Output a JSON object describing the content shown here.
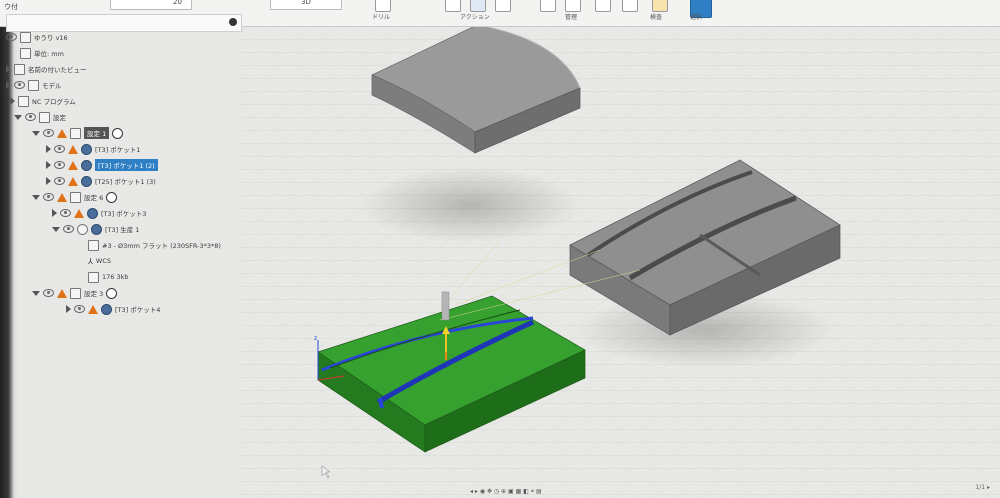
{
  "toolbar": {
    "zoom_label": "20",
    "view_label": "3D",
    "drill_label": "ドリル",
    "action_label": "アクション",
    "manage_label": "管理",
    "inspect_label": "検査",
    "select_label": "選択",
    "left_label": "ウ付"
  },
  "browser": {
    "title": "",
    "items": [
      {
        "label": "ゆうり v16"
      },
      {
        "label": "単位: mm"
      },
      {
        "label": "名前の付いたビュー"
      },
      {
        "label": "モデル"
      },
      {
        "label": "NC プログラム"
      },
      {
        "label": "設定"
      },
      {
        "label": "設定 1"
      },
      {
        "label": "[T3] ポケット1"
      },
      {
        "label": "[T3] ポケット1 (2)"
      },
      {
        "label": "[T25] ポケット1 (3)"
      },
      {
        "label": "設定 6"
      },
      {
        "label": "[T3] ポケット3"
      },
      {
        "label": "[T3] 生産 1"
      },
      {
        "label": "#3 - Ø3mm フラット (230SFR-3*3*8)"
      },
      {
        "label": "WCS"
      },
      {
        "label": "176 3kb"
      },
      {
        "label": "設定 3"
      },
      {
        "label": "[T3] ポケット4"
      }
    ]
  },
  "colors": {
    "stock_gray": "#8e8e8e",
    "toolpath_green": "#2f8f2b",
    "toolpath_blue": "#2a46d8",
    "selection_blue": "#2f7fc4"
  },
  "statusbar": {
    "text": "◂ ▸ ◉ ✥ ◷ ⊕ ▣ ▦ ◧ ⌖ ▤"
  },
  "corner_text": "1/1 ▸"
}
